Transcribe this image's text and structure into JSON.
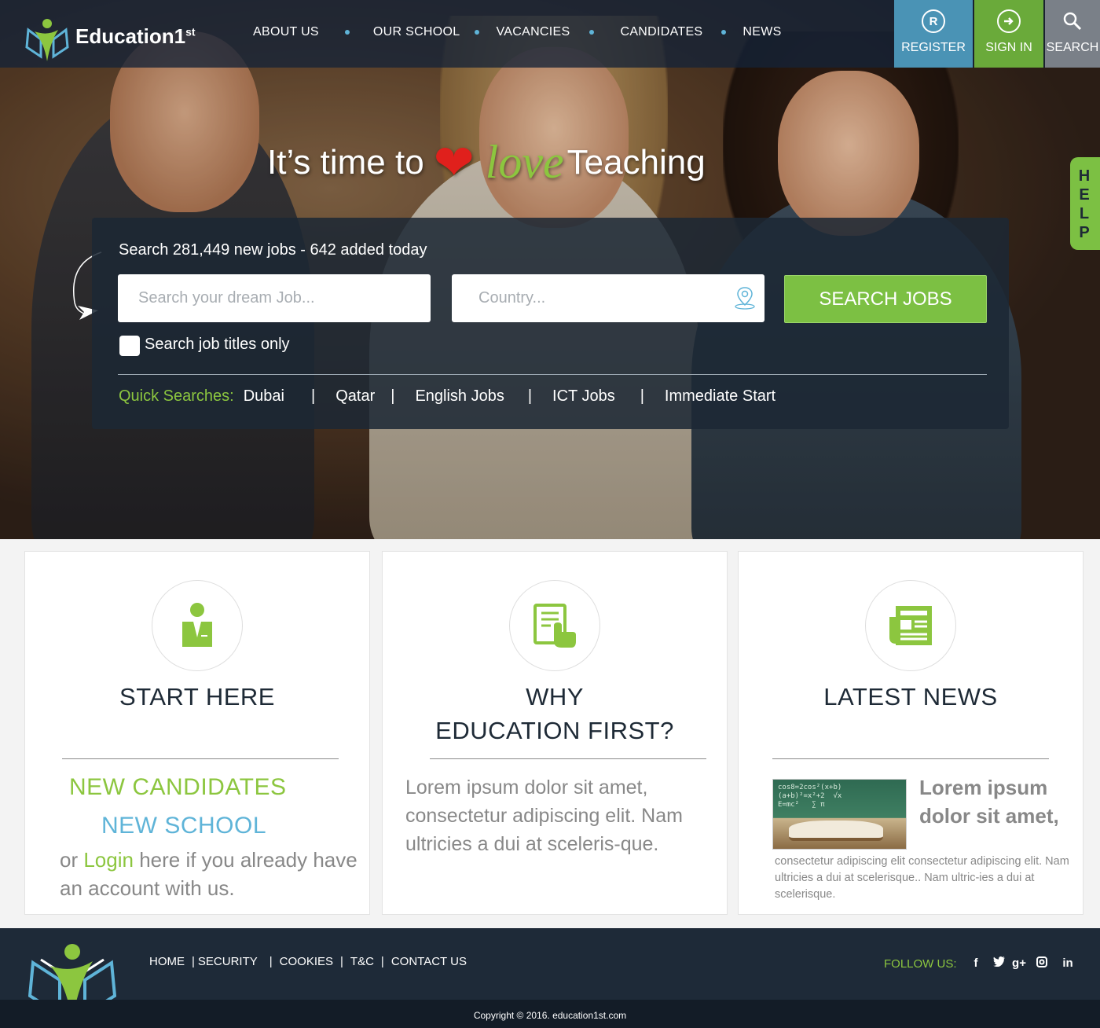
{
  "brand": {
    "name": "Education1",
    "sup": "st"
  },
  "nav": {
    "items": [
      "ABOUT US",
      "OUR SCHOOL",
      "VACANCIES",
      "CANDIDATES",
      "NEWS"
    ]
  },
  "top_buttons": {
    "register": "REGISTER",
    "register_icon": "R",
    "signin": "SIGN IN",
    "search": "SEARCH"
  },
  "help_tab": [
    "H",
    "E",
    "L",
    "P"
  ],
  "hero": {
    "tagline_prefix": "It’s time to",
    "tagline_love": "love",
    "tagline_suffix": "Teaching"
  },
  "search": {
    "headline": "Search 281,449 new jobs - 642 added today",
    "job_placeholder": "Search your dream Job...",
    "country_placeholder": "Country...",
    "button": "SEARCH JOBS",
    "titles_only_label": "Search job titles only",
    "quick_label": "Quick Searches:",
    "quick": [
      "Dubai",
      "Qatar",
      "English Jobs",
      "ICT Jobs",
      "Immediate Start"
    ],
    "separator": "|"
  },
  "cards": {
    "start": {
      "title": "START HERE",
      "new_candidates": "NEW CANDIDATES",
      "new_school": "NEW SCHOOL",
      "text_pre": "or ",
      "login": "Login",
      "text_post": " here if you already have an account with us."
    },
    "why": {
      "title_line1": "WHY",
      "title_line2": "EDUCATION FIRST?",
      "text": "Lorem ipsum dolor sit amet, consectetur adipiscing elit. Nam ultricies a dui at sceleris-que."
    },
    "news": {
      "title": "LATEST  NEWS",
      "headline": "Lorem ipsum dolor sit amet,",
      "body": "consectetur adipiscing elit consectetur adipiscing elit. Nam ultricies a dui at scelerisque.. Nam ultric-ies a dui at scelerisque."
    }
  },
  "footer": {
    "links": [
      "HOME",
      "SECURITY",
      "COOKIES",
      "T&C",
      "CONTACT US"
    ],
    "separator": "|",
    "follow": "FOLLOW US:",
    "social": [
      "f",
      "t",
      "g+",
      "ig",
      "in"
    ],
    "copyright": "Copyright © 2016. education1st.com"
  },
  "colors": {
    "green": "#7cc043",
    "blue": "#4a93b5",
    "navy": "#1e2a38",
    "gray_text": "#888888"
  }
}
